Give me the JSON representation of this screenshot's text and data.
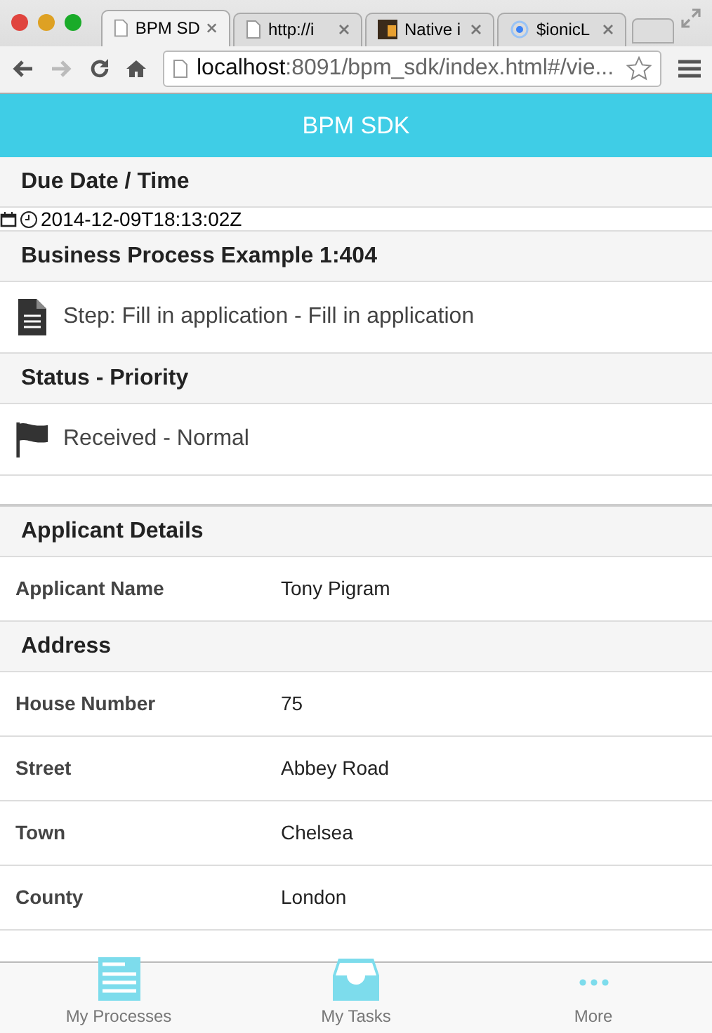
{
  "browser": {
    "tabs": [
      {
        "title": "BPM SD",
        "kind": "page",
        "selected": true
      },
      {
        "title": "http://i",
        "kind": "page",
        "selected": false
      },
      {
        "title": "Native i",
        "kind": "dw",
        "selected": false
      },
      {
        "title": "$ionicL",
        "kind": "spinner",
        "selected": false
      }
    ],
    "url_host": "localhost",
    "url_rest": ":8091/bpm_sdk/index.html#/vie..."
  },
  "header": {
    "title": "BPM SDK"
  },
  "sections": [
    {
      "kind": "divider",
      "title": "Due Date / Time"
    },
    {
      "kind": "timestamp",
      "text": "2014-12-09T18:13:02Z"
    },
    {
      "kind": "divider",
      "title": "Business Process Example 1:404"
    },
    {
      "kind": "document",
      "text": "Step: Fill in application - Fill in application"
    },
    {
      "kind": "divider",
      "title": "Status - Priority"
    },
    {
      "kind": "flag",
      "text": "Received - Normal"
    },
    {
      "kind": "spacer"
    },
    {
      "kind": "divider",
      "title": "Applicant Details"
    },
    {
      "kind": "field",
      "label": "Applicant Name",
      "value": "Tony Pigram"
    },
    {
      "kind": "divider",
      "title": "Address"
    },
    {
      "kind": "field",
      "label": "House Number",
      "value": "75"
    },
    {
      "kind": "field",
      "label": "Street",
      "value": "Abbey Road"
    },
    {
      "kind": "field",
      "label": "Town",
      "value": "Chelsea"
    },
    {
      "kind": "field",
      "label": "County",
      "value": "London"
    }
  ],
  "tab_bar": [
    {
      "label": "My Processes",
      "kind": "list"
    },
    {
      "label": "My Tasks",
      "kind": "inbox"
    },
    {
      "label": "More",
      "kind": "dots"
    }
  ]
}
